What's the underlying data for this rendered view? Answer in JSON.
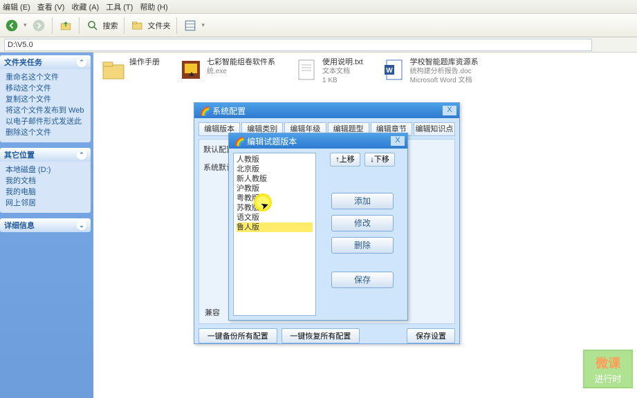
{
  "menu": {
    "edit": "编辑 (E)",
    "view": "查看 (V)",
    "fav": "收藏 (A)",
    "tools": "工具 (T)",
    "help": "帮助 (H)"
  },
  "toolbar": {
    "search": "搜索",
    "folders": "文件夹"
  },
  "address": {
    "path": "D:\\V5.0"
  },
  "sidebar": {
    "tasks_title": "文件夹任务",
    "tasks": [
      "重命名这个文件",
      "移动这个文件",
      "复制这个文件",
      "将这个文件发布到 Web",
      "以电子邮件形式发送此",
      "删除这个文件"
    ],
    "places_title": "其它位置",
    "places": [
      "本地磁盘 (D:)",
      "我的文档",
      "我的电脑",
      "网上邻居"
    ],
    "details_title": "详细信息"
  },
  "files": {
    "f1": {
      "name": "操作手册"
    },
    "f2": {
      "name": "七彩智能组卷软件系",
      "sub": "统.exe"
    },
    "f3": {
      "name": "使用说明.txt",
      "sub1": "文本文档",
      "sub2": "1 KB"
    },
    "f4": {
      "name": "学校智能题库资源系",
      "sub1": "统构建分析报告.doc",
      "sub2": "Microsoft Word 文档"
    }
  },
  "dlg1": {
    "title": "系统配置",
    "tabs": [
      "编辑版本",
      "编辑类别",
      "编辑年级",
      "编辑题型",
      "编辑章节",
      "编辑知识点"
    ],
    "row1": "默认配置",
    "row2": "系统默认",
    "btn_backup": "一键备份所有配置",
    "btn_restore": "一键恢复所有配置",
    "btn_save": "保存设置",
    "compat": "兼容"
  },
  "dlg2": {
    "title": "编辑试题版本",
    "items": [
      "人教版",
      "北京版",
      "新人教版",
      "沪教版",
      "粤教版",
      "苏教版",
      "语文版",
      "鲁人版"
    ],
    "up": "↑上移",
    "down": "↓下移",
    "add": "添加",
    "edit": "修改",
    "del": "删除",
    "save": "保存"
  },
  "watermark": {
    "l1": "微课",
    "l2": "进行时"
  }
}
